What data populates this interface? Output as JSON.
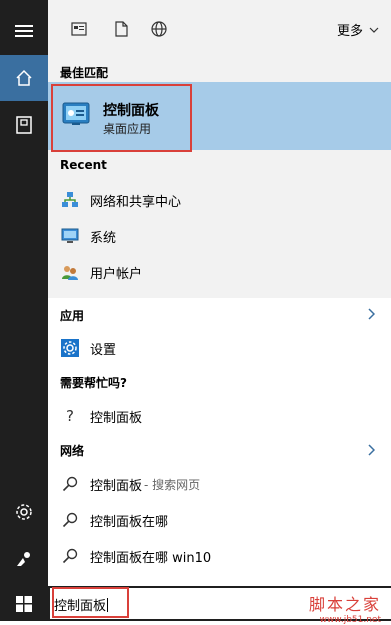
{
  "sections": {
    "best_match": "最佳匹配",
    "recent": "Recent",
    "apps": "应用",
    "help": "需要帮忙吗?",
    "web": "网络"
  },
  "toolbar": {
    "more_label": "更多"
  },
  "best_match": {
    "title": "控制面板",
    "subtitle": "桌面应用"
  },
  "recent_items": [
    {
      "label": "网络和共享中心",
      "icon": "network-share-icon"
    },
    {
      "label": "系统",
      "icon": "system-icon"
    },
    {
      "label": "用户帐户",
      "icon": "user-accounts-icon"
    }
  ],
  "apps_items": [
    {
      "label": "设置",
      "icon": "settings-gear-icon"
    }
  ],
  "help_items": [
    {
      "label": "控制面板",
      "icon": "question-icon"
    }
  ],
  "web_items": [
    {
      "label": "控制面板",
      "suffix": " - 搜索网页"
    },
    {
      "label": "控制面板在哪",
      "suffix": ""
    },
    {
      "label": "控制面板在哪 win10",
      "suffix": ""
    }
  ],
  "search": {
    "query": "控制面板"
  },
  "watermark": {
    "title": "脚本之家",
    "url": "www.jb51.net"
  },
  "colors": {
    "accent": "#3a6fa0",
    "highlight": "#a6cbe8",
    "annotation": "#d9403a",
    "rail": "#1f1f1f"
  }
}
